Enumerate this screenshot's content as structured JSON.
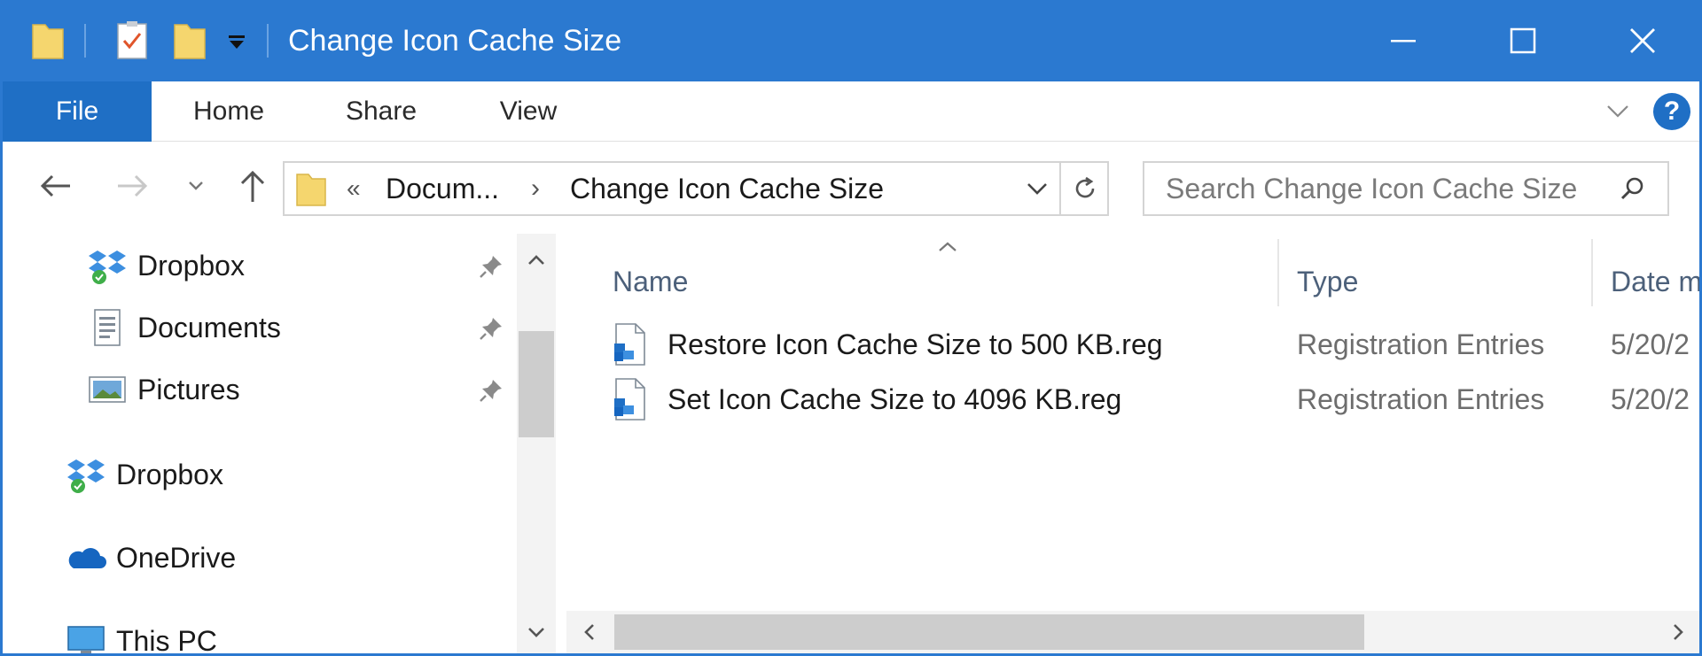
{
  "window": {
    "title": "Change Icon Cache Size",
    "accent_color": "#2b79d0",
    "file_tab_color": "#1f6fc5"
  },
  "quick_access": {
    "icons": [
      "folder-icon",
      "properties-icon",
      "new-folder-icon",
      "customize-quick-access-icon"
    ]
  },
  "window_controls": {
    "minimize": "minimize-icon",
    "maximize": "maximize-icon",
    "close": "close-icon"
  },
  "ribbon": {
    "tabs": [
      {
        "label": "File",
        "active": true
      },
      {
        "label": "Home"
      },
      {
        "label": "Share"
      },
      {
        "label": "View"
      }
    ],
    "help_label": "?"
  },
  "address_bar": {
    "overflow_label": "«",
    "crumbs": [
      "Docum...",
      "Change Icon Cache Size"
    ],
    "separator": "›"
  },
  "search": {
    "placeholder": "Search Change Icon Cache Size"
  },
  "nav_pane": {
    "quick_access_items": [
      {
        "label": "Dropbox",
        "icon": "dropbox-icon",
        "pinned": true
      },
      {
        "label": "Documents",
        "icon": "documents-icon",
        "pinned": true
      },
      {
        "label": "Pictures",
        "icon": "pictures-icon",
        "pinned": true
      }
    ],
    "roots": [
      {
        "label": "Dropbox",
        "icon": "dropbox-icon"
      },
      {
        "label": "OneDrive",
        "icon": "onedrive-icon"
      },
      {
        "label": "This PC",
        "icon": "this-pc-icon"
      }
    ]
  },
  "file_list": {
    "columns": [
      "Name",
      "Type",
      "Date m"
    ],
    "files": [
      {
        "name": "Restore Icon Cache Size to 500 KB.reg",
        "type": "Registration Entries",
        "date": "5/20/2"
      },
      {
        "name": "Set Icon Cache Size to 4096 KB.reg",
        "type": "Registration Entries",
        "date": "5/20/2"
      }
    ]
  }
}
